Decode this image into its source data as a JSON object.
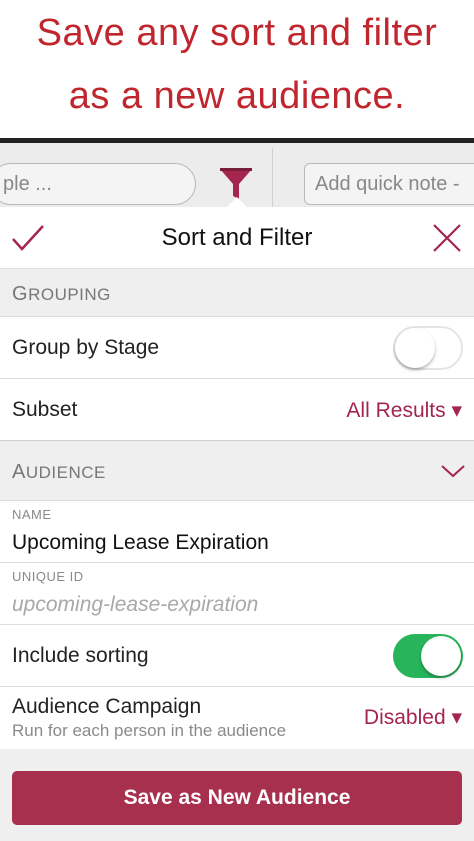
{
  "promo": {
    "line1": "Save any sort and filter",
    "line2": "as a new audience."
  },
  "topbar": {
    "search_text": "ple ...",
    "quick_note_placeholder": "Add quick note -"
  },
  "sheet": {
    "title": "Sort and Filter"
  },
  "grouping": {
    "header_first": "G",
    "header_rest": "ROUPING",
    "group_by_stage_label": "Group by Stage",
    "group_by_stage_on": false,
    "subset_label": "Subset",
    "subset_value": "All Results ▾"
  },
  "audience": {
    "header_first": "A",
    "header_rest": "UDIENCE",
    "name_label": "NAME",
    "name_value": "Upcoming Lease Expiration",
    "unique_id_label": "UNIQUE ID",
    "unique_id_placeholder": "upcoming-lease-expiration",
    "include_sorting_label": "Include sorting",
    "include_sorting_on": true,
    "campaign_label": "Audience Campaign",
    "campaign_sub": "Run for each person in the audience",
    "campaign_value": "Disabled ▾"
  },
  "footer": {
    "save_label": "Save as New Audience"
  },
  "colors": {
    "promo_red": "#c0262d",
    "accent": "#a4254e",
    "toggle_on": "#27b45a",
    "button_bg": "#a7304f"
  },
  "icons": [
    "funnel-icon",
    "checkmark-icon",
    "close-icon",
    "chevron-down-icon"
  ]
}
